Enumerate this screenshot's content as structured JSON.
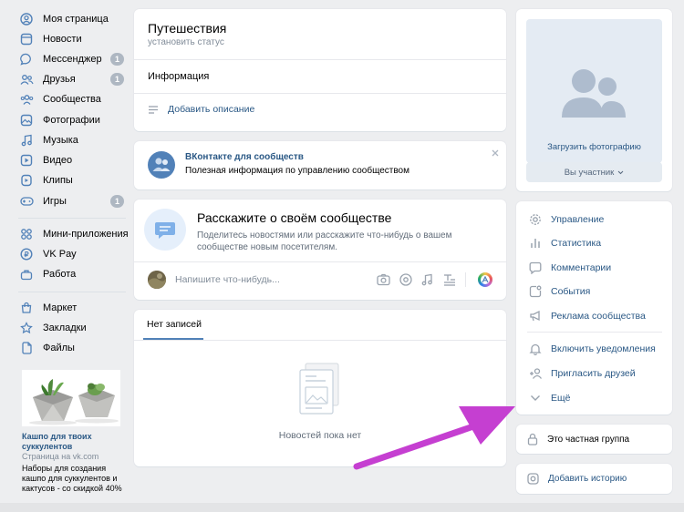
{
  "sidebar": {
    "items": [
      {
        "label": "Моя страница",
        "icon": "user-circle-icon"
      },
      {
        "label": "Новости",
        "icon": "news-icon"
      },
      {
        "label": "Мессенджер",
        "icon": "message-icon",
        "badge": "1"
      },
      {
        "label": "Друзья",
        "icon": "friends-icon",
        "badge": "1"
      },
      {
        "label": "Сообщества",
        "icon": "communities-icon"
      },
      {
        "label": "Фотографии",
        "icon": "photos-icon"
      },
      {
        "label": "Музыка",
        "icon": "music-icon"
      },
      {
        "label": "Видео",
        "icon": "video-icon"
      },
      {
        "label": "Клипы",
        "icon": "clips-icon"
      },
      {
        "label": "Игры",
        "icon": "games-icon",
        "badge": "1"
      },
      {
        "label": "Мини-приложения",
        "icon": "mini-apps-icon"
      },
      {
        "label": "VK Pay",
        "icon": "vkpay-icon"
      },
      {
        "label": "Работа",
        "icon": "work-icon"
      },
      {
        "label": "Маркет",
        "icon": "market-icon"
      },
      {
        "label": "Закладки",
        "icon": "bookmarks-icon"
      },
      {
        "label": "Файлы",
        "icon": "files-icon"
      }
    ]
  },
  "ad": {
    "title": "Кашпо для твоих суккулентов",
    "source": "Страница на vk.com",
    "text": "Наборы для создания кашпо для суккулентов и кактусов - со скидкой 40%"
  },
  "group": {
    "name": "Путешествия",
    "status": "установить статус",
    "info_label": "Информация",
    "add_description": "Добавить описание"
  },
  "promo": {
    "title": "ВКонтакте для сообществ",
    "text": "Полезная информация по управлению сообществом"
  },
  "tell": {
    "title": "Расскажите о своём сообществе",
    "text": "Поделитесь новостями или расскажите что-нибудь о вашем сообществе новым посетителям."
  },
  "composer": {
    "placeholder": "Напишите что-нибудь..."
  },
  "posts": {
    "tab": "Нет записей",
    "empty": "Новостей пока нет"
  },
  "right": {
    "upload_photo": "Загрузить фотографию",
    "member_button": "Вы участник",
    "menu": [
      {
        "label": "Управление",
        "icon": "gear-icon"
      },
      {
        "label": "Статистика",
        "icon": "stats-icon"
      },
      {
        "label": "Комментарии",
        "icon": "comment-icon"
      },
      {
        "label": "События",
        "icon": "events-icon"
      },
      {
        "label": "Реклама сообщества",
        "icon": "megaphone-icon"
      },
      {
        "label": "Включить уведомления",
        "icon": "bell-icon"
      },
      {
        "label": "Пригласить друзей",
        "icon": "invite-icon"
      },
      {
        "label": "Ещё",
        "icon": "chevron-down-icon"
      }
    ],
    "private_group": "Это частная группа",
    "add_story": "Добавить историю"
  },
  "colors": {
    "link": "#2a5885",
    "accent": "#5181b8",
    "arrow": "#c53fd1",
    "icon": "#99a2ad"
  }
}
